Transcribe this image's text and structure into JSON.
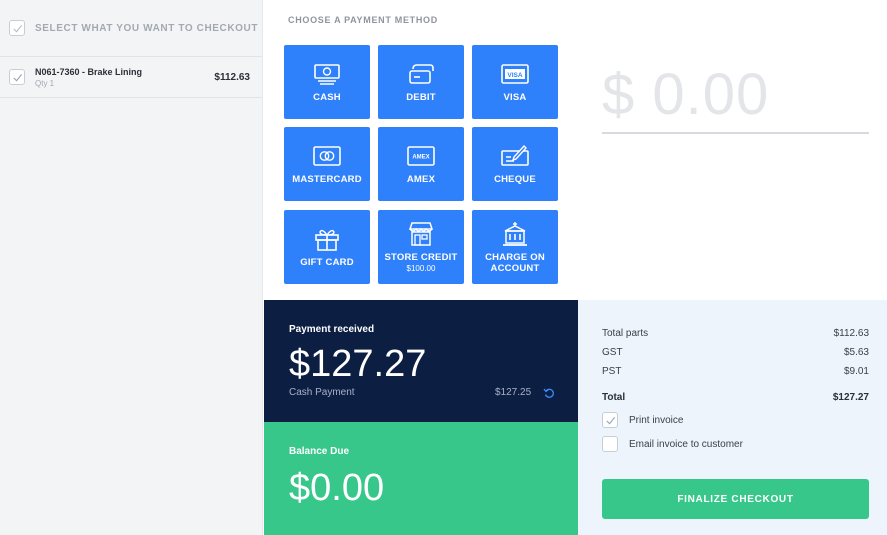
{
  "left": {
    "header": "SELECT WHAT YOU WANT TO CHECKOUT",
    "items": [
      {
        "name": "N061-7360 - Brake Lining",
        "qty": "Qty 1",
        "price": "$112.63"
      }
    ]
  },
  "payment": {
    "title": "CHOOSE A PAYMENT METHOD",
    "methods": [
      {
        "label": "CASH",
        "icon": "cash-icon"
      },
      {
        "label": "DEBIT",
        "icon": "debit-card-icon"
      },
      {
        "label": "VISA",
        "icon": "visa-icon",
        "badge": "VISA"
      },
      {
        "label": "MASTERCARD",
        "icon": "mastercard-icon"
      },
      {
        "label": "AMEX",
        "icon": "amex-icon",
        "badge": "AMEX"
      },
      {
        "label": "CHEQUE",
        "icon": "cheque-icon"
      },
      {
        "label": "GIFT CARD",
        "icon": "gift-icon"
      },
      {
        "label": "STORE CREDIT",
        "sub": "$100.00",
        "icon": "store-icon"
      },
      {
        "label": "CHARGE ON ACCOUNT",
        "icon": "building-icon"
      }
    ]
  },
  "amount_display": "$ 0.00",
  "received": {
    "header": "Payment received",
    "amount": "$127.27",
    "method": "Cash Payment",
    "method_amount": "$127.25"
  },
  "balance": {
    "header": "Balance Due",
    "amount": "$0.00"
  },
  "summary": {
    "rows": [
      {
        "label": "Total parts",
        "value": "$112.63"
      },
      {
        "label": "GST",
        "value": "$5.63"
      },
      {
        "label": "PST",
        "value": "$9.01"
      }
    ],
    "total_label": "Total",
    "total_value": "$127.27",
    "print_invoice": "Print invoice",
    "email_invoice": "Email invoice to customer",
    "finalize": "FINALIZE CHECKOUT"
  },
  "colors": {
    "primary_blue": "#2f80fb",
    "navy": "#0d1e43",
    "green": "#38c78b"
  }
}
